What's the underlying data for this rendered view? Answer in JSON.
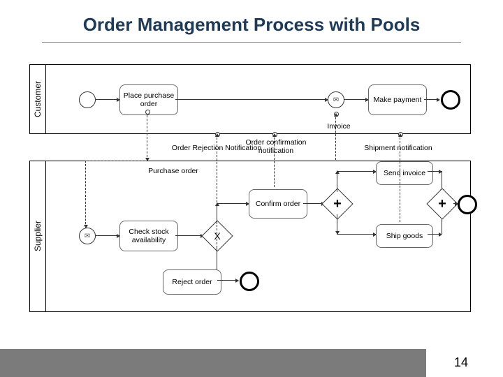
{
  "title": "Order Management Process with Pools",
  "page_number": "14",
  "pools": {
    "customer": {
      "label": "Customer",
      "tasks": {
        "place_po": "Place purchase order",
        "make_payment": "Make payment"
      }
    },
    "supplier": {
      "label": "Supplier",
      "tasks": {
        "check_stock": "Check stock availability",
        "confirm_order": "Confirm order",
        "reject_order": "Reject order",
        "ship_goods": "Ship goods",
        "send_invoice": "Send invoice"
      },
      "internal_labels": {
        "purchase_order": "Purchase order"
      }
    }
  },
  "messages": {
    "invoice": "Invoice",
    "order_rejection": "Order Rejection Notification",
    "order_confirm": "Order confirmation notification",
    "shipment": "Shipment notification"
  }
}
